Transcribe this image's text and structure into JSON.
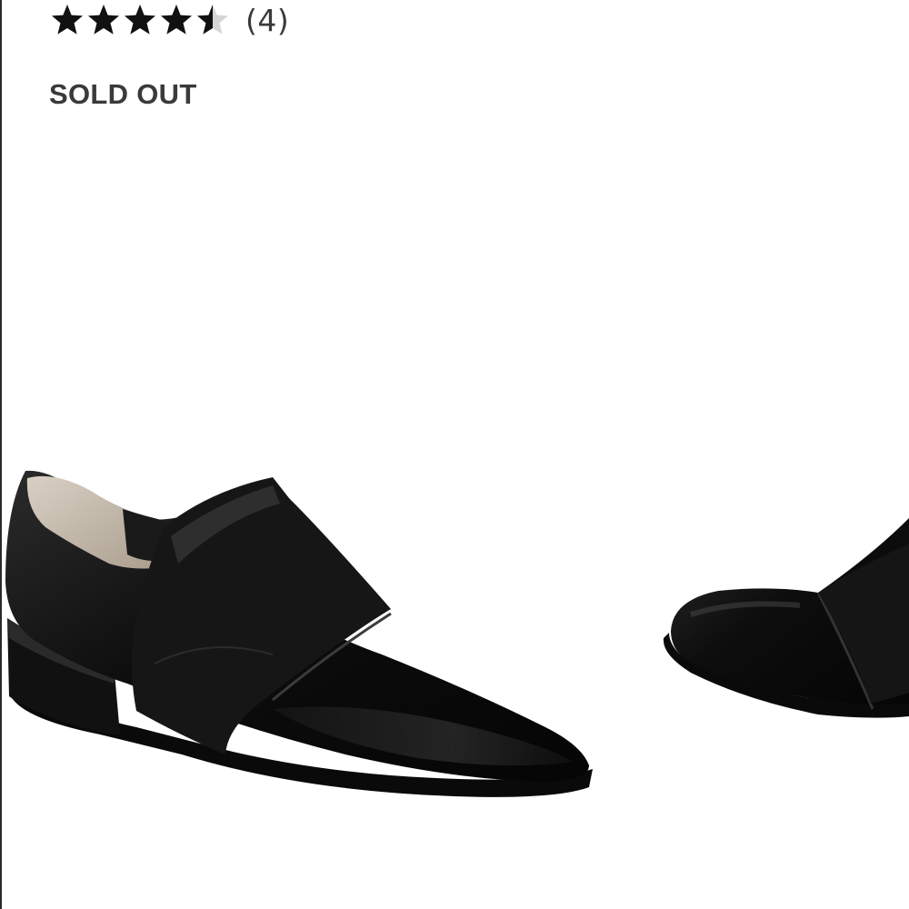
{
  "product": {
    "rating": {
      "value": 4.5,
      "max": 5,
      "icon": "star-icon"
    },
    "review_count": "(4)",
    "availability": "SOLD OUT"
  },
  "colors": {
    "star_filled": "#111111",
    "star_empty": "#d6d6d6",
    "text": "#3a3a3a",
    "background": "#ffffff"
  }
}
